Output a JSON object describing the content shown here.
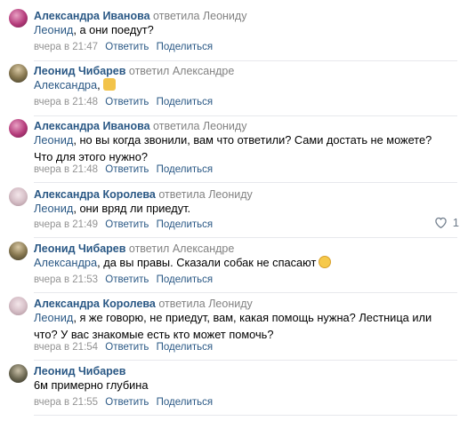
{
  "actions": {
    "reply": "Ответить",
    "share": "Поделиться"
  },
  "comments": [
    {
      "author": "Александра Иванова",
      "reply_to": "ответила Леониду",
      "mention": "Леонид",
      "text": ", а они поедут?",
      "time": "вчера в 21:47"
    },
    {
      "author": "Леонид Чибарев",
      "reply_to": "ответил Александре",
      "mention": "Александра",
      "text": ",",
      "emoji": "person-emoji",
      "time": "вчера в 21:48"
    },
    {
      "author": "Александра Иванова",
      "reply_to": "ответила Леониду",
      "mention": "Леонид",
      "text": ", но вы когда звонили, вам что ответили? Сами достать не можете? Что для этого нужно?",
      "time": "вчера в 21:48"
    },
    {
      "author": "Александра Королева",
      "reply_to": "ответила Леониду",
      "mention": "Леонид",
      "text": ", они вряд ли приедут.",
      "time": "вчера в 21:49",
      "likes": "1"
    },
    {
      "author": "Леонид Чибарев",
      "reply_to": "ответил Александре",
      "mention": "Александра",
      "text": ", да вы правы. Сказали собак не спасают",
      "emoji": "sad-face-emoji",
      "time": "вчера в 21:53"
    },
    {
      "author": "Александра Королева",
      "reply_to": "ответила Леониду",
      "mention": "Леонид",
      "text": ", я же говорю, не приедут, вам, какая помощь нужна? Лестница или что? У вас знакомые есть кто может помочь?",
      "time": "вчера в 21:54"
    },
    {
      "author": "Леонид Чибарев",
      "reply_to": "",
      "mention": "",
      "text": "6м примерно глубина",
      "time": "вчера в 21:55"
    }
  ]
}
